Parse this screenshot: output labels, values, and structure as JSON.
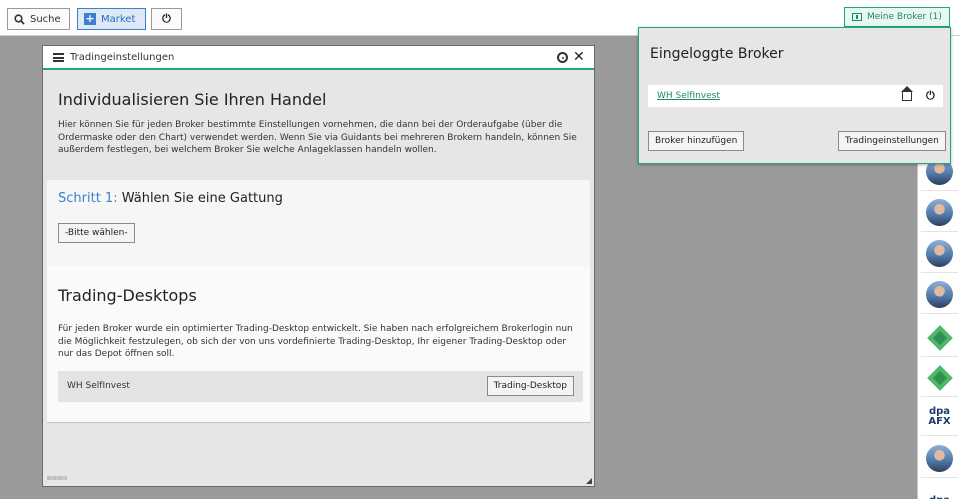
{
  "toolbar": {
    "search_label": "Suche",
    "market_label": "Market",
    "meine_broker_label": "Meine Broker (1)"
  },
  "dialog": {
    "title": "Tradingeinstellungen",
    "heading": "Individualisieren Sie Ihren Handel",
    "intro": "Hier können Sie für jeden Broker bestimmte Einstellungen vornehmen, die dann bei der Orderaufgabe (über die Ordermaske oder den Chart) verwendet werden. Wenn Sie via Guidants bei mehreren Brokern handeln, können Sie außerdem festlegen, bei welchem Broker Sie welche Anlageklassen handeln wollen.",
    "step_prefix": "Schritt 1:",
    "step_text": "Wählen Sie eine Gattung",
    "select_label": "-Bitte wählen-",
    "desktops_heading": "Trading-Desktops",
    "desktops_text": "Für jeden Broker wurde ein optimierter Trading-Desktop entwickelt. Sie haben nach erfolgreichem Brokerlogin nun die Möglichkeit festzulegen, ob sich der von uns vordefinierte Trading-Desktop, Ihr eigener Trading-Desktop oder nur das Depot öffnen soll.",
    "broker_name": "WH SelfInvest",
    "desktop_button": "Trading-Desktop"
  },
  "popup": {
    "title": "Eingeloggte Broker",
    "broker_link": "WH SelfInvest",
    "add_broker_button": "Broker hinzufügen",
    "settings_button": "Tradingeinstellungen"
  },
  "sidebar": {
    "dpa_label_1": "dpa",
    "dpa_label_2": "AFX",
    "dpa_label_3": "dpa"
  },
  "colors": {
    "accent_green": "#23a37e",
    "accent_blue": "#3d7fd1",
    "backdrop": "#9a9a9a"
  }
}
